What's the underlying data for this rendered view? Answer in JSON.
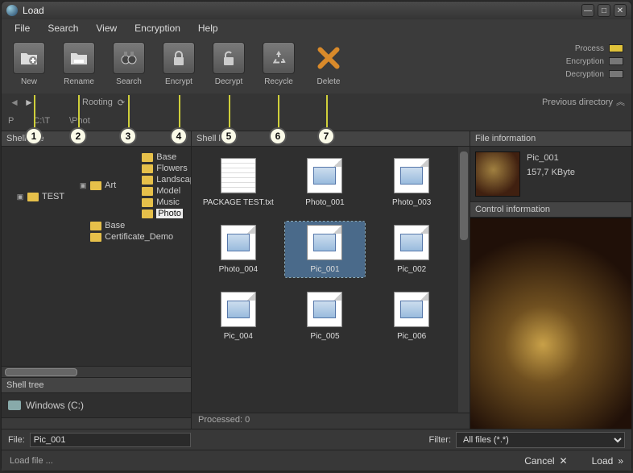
{
  "window": {
    "title": "Load"
  },
  "menu": {
    "items": [
      "File",
      "Search",
      "View",
      "Encryption",
      "Help"
    ]
  },
  "toolbar": {
    "buttons": [
      {
        "name": "new",
        "label": "New"
      },
      {
        "name": "rename",
        "label": "Rename"
      },
      {
        "name": "search",
        "label": "Search"
      },
      {
        "name": "encrypt",
        "label": "Encrypt"
      },
      {
        "name": "decrypt",
        "label": "Decrypt"
      },
      {
        "name": "recycle",
        "label": "Recycle"
      },
      {
        "name": "delete",
        "label": "Delete"
      }
    ]
  },
  "status_indicators": {
    "process": "Process",
    "encryption": "Encryption",
    "decryption": "Decryption"
  },
  "navbar": {
    "rooting": "Rooting",
    "previous": "Previous directory"
  },
  "pathbar": {
    "prefix": "P",
    "mid": "C:\\T",
    "tail": "\\Phot"
  },
  "panels": {
    "shelltree": "Shell tree",
    "shelllist": "Shell list",
    "fileinfo": "File information",
    "controlinfo": "Control information"
  },
  "tree": {
    "root": "TEST",
    "art": "Art",
    "children": [
      "Base",
      "Flowers",
      "Landscape",
      "Model",
      "Music",
      "Photo"
    ],
    "selected": "Photo",
    "siblings": [
      "Base",
      "Certificate_Demo"
    ]
  },
  "drive": {
    "label": "Windows (C:)"
  },
  "list": {
    "items": [
      {
        "label": "PACKAGE TEST.txt",
        "type": "txt"
      },
      {
        "label": "Photo_001",
        "type": "img"
      },
      {
        "label": "Photo_003",
        "type": "img"
      },
      {
        "label": "Photo_004",
        "type": "img"
      },
      {
        "label": "Pic_001",
        "type": "img",
        "selected": true
      },
      {
        "label": "Pic_002",
        "type": "img"
      },
      {
        "label": "Pic_004",
        "type": "img"
      },
      {
        "label": "Pic_005",
        "type": "img"
      },
      {
        "label": "Pic_006",
        "type": "img"
      }
    ],
    "processed": "Processed: 0"
  },
  "fileinfo": {
    "name": "Pic_001",
    "size": "157,7 KByte"
  },
  "bottom": {
    "file_label": "File:",
    "file_value": "Pic_001",
    "filter_label": "Filter:",
    "filter_value": "All files (*.*)",
    "status": "Load file ...",
    "cancel": "Cancel",
    "load": "Load"
  },
  "callouts": [
    "1",
    "2",
    "3",
    "4",
    "5",
    "6",
    "7"
  ]
}
